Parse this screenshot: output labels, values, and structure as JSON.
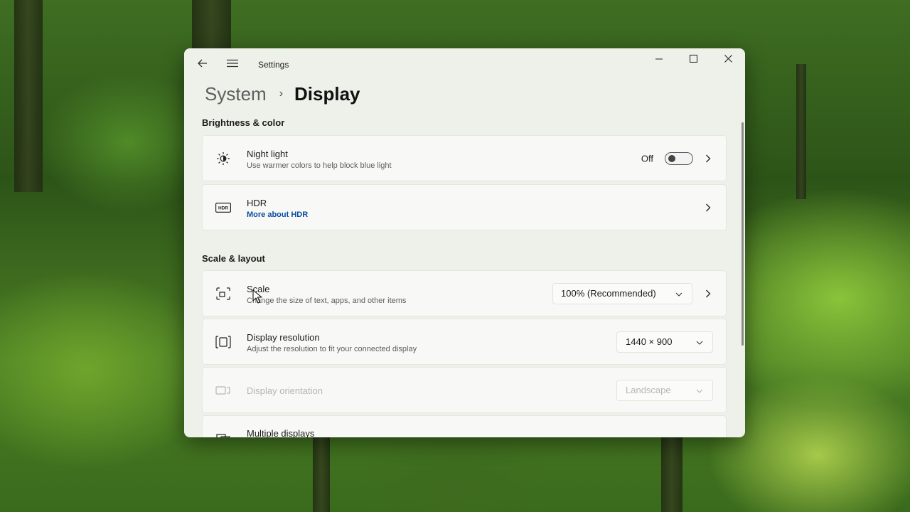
{
  "window": {
    "app_title": "Settings"
  },
  "breadcrumb": {
    "parent": "System",
    "separator": "›",
    "current": "Display"
  },
  "sections": {
    "brightness": {
      "title": "Brightness & color",
      "night_light": {
        "title": "Night light",
        "subtitle": "Use warmer colors to help block blue light",
        "toggle_label": "Off",
        "toggle_on": false
      },
      "hdr": {
        "title": "HDR",
        "link": "More about HDR"
      }
    },
    "scale_layout": {
      "title": "Scale & layout",
      "scale": {
        "title": "Scale",
        "subtitle": "Change the size of text, apps, and other items",
        "value": "100% (Recommended)"
      },
      "resolution": {
        "title": "Display resolution",
        "subtitle": "Adjust the resolution to fit your connected display",
        "value": "1440 × 900"
      },
      "orientation": {
        "title": "Display orientation",
        "value": "Landscape",
        "disabled": true
      },
      "multiple_displays": {
        "title": "Multiple displays"
      }
    }
  },
  "colors": {
    "window_bg": "#eef1e9",
    "card_bg": "#f8f9f6",
    "link": "#0b4ea2",
    "disabled_text": "#b4b7b0"
  },
  "icons": {
    "back": "back-arrow-icon",
    "menu": "hamburger-menu-icon",
    "minimize": "minimize-icon",
    "maximize": "maximize-icon",
    "close": "close-icon",
    "night_light": "brightness-sun-icon",
    "hdr": "hdr-icon",
    "scale": "scale-icon",
    "resolution": "resolution-icon",
    "orientation": "orientation-icon",
    "multiple_displays": "multiple-displays-icon"
  }
}
